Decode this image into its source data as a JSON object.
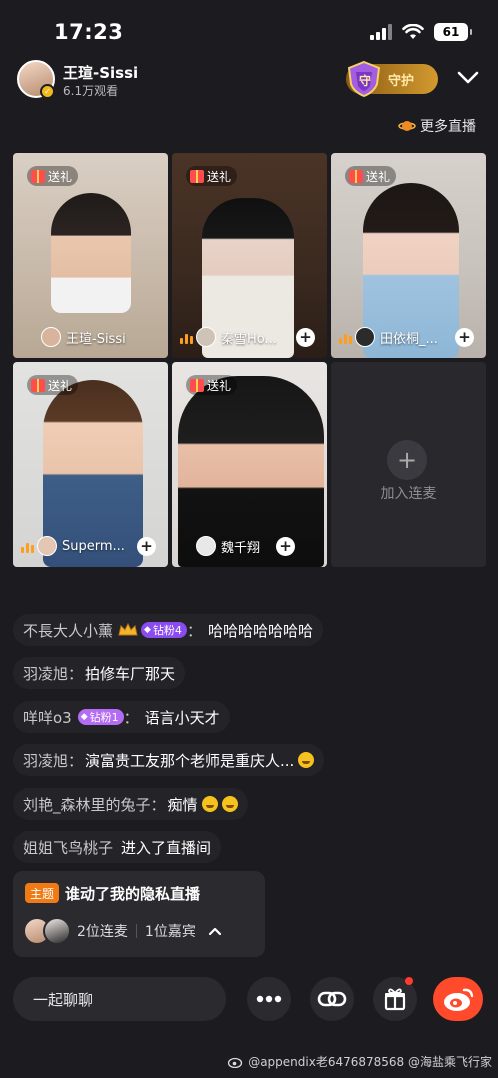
{
  "status_bar": {
    "time": "17:23",
    "battery": "61"
  },
  "header": {
    "host_name": "王瑄-Sissi",
    "viewers": "6.1万观看",
    "guard_label": "守护",
    "guard_badge": "守"
  },
  "more_live": "更多直播",
  "tiles": [
    {
      "gift": "送礼",
      "name": "王瑄-Sissi"
    },
    {
      "gift": "送礼",
      "name": "秦雪Ho..."
    },
    {
      "gift": "送礼",
      "name": "田依桐_..."
    },
    {
      "gift": "送礼",
      "name": "Superm..."
    },
    {
      "gift": "送礼",
      "name": "魏千翔"
    }
  ],
  "add_tile": {
    "label": "加入连麦"
  },
  "chat": [
    {
      "user": "不長大人小薰",
      "badge": "钻粉4",
      "message": "哈哈哈哈哈哈哈"
    },
    {
      "user": "羽凌旭：",
      "message": "拍修车厂那天"
    },
    {
      "user": "咩咩o3",
      "badge": "钻粉1",
      "message": "语言小天才"
    },
    {
      "user": "羽凌旭：",
      "message": "演富贵工友那个老师是重庆人..."
    },
    {
      "user": "刘艳_森林里的兔子：",
      "message": "痴情"
    },
    {
      "user": "姐姐飞鸟桃子",
      "message": "进入了直播间"
    }
  ],
  "topic_card": {
    "tag": "主题",
    "title": "谁动了我的隐私直播",
    "guests": "2位连麦",
    "honored": "1位嘉宾"
  },
  "bottom_bar": {
    "chat_placeholder": "一起聊聊"
  },
  "watermark": "@appendix老6476878568 @海盐乘飞行家",
  "colors": {
    "background": "#1c1c20",
    "accent_orange": "#f07b16",
    "fan_badge": "#8a4bf0",
    "weibo_red": "#ff4a2b",
    "guard_gold": "#d29a2f"
  }
}
